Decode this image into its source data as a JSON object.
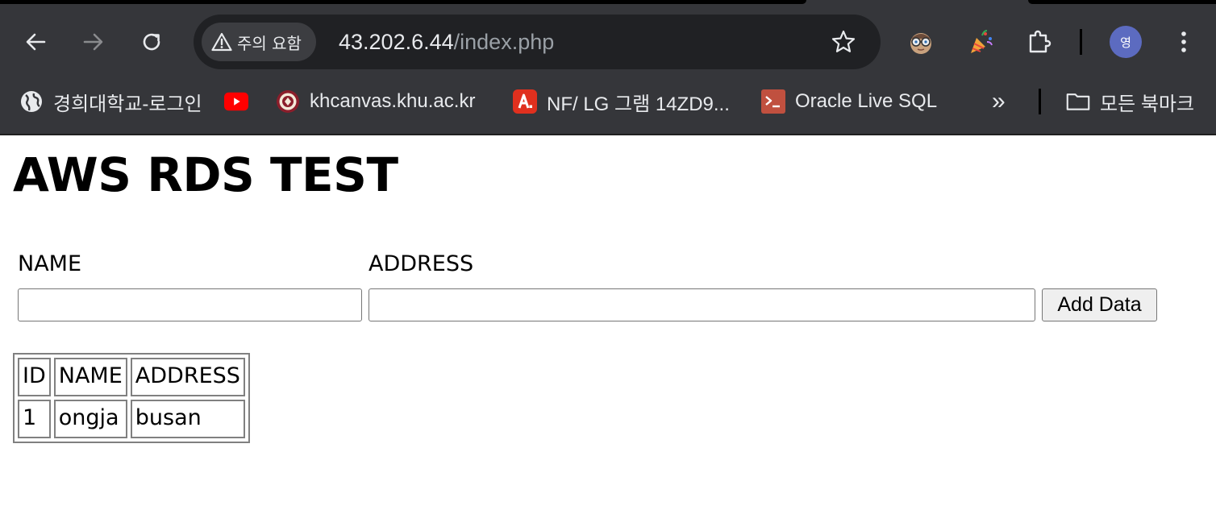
{
  "browser": {
    "security_label": "주의 요함",
    "url_host": "43.202.6.44",
    "url_path": "/index.php",
    "profile_initial": "영",
    "bookmarks": [
      {
        "label": "경희대학교-로그인",
        "icon": "globe-icon"
      },
      {
        "label": "",
        "icon": "youtube-icon"
      },
      {
        "label": "khcanvas.khu.ac.kr",
        "icon": "khu-seal-icon"
      },
      {
        "label": "NF/ LG 그램 14ZD9...",
        "icon": "acrobat-icon"
      },
      {
        "label": "Oracle Live SQL",
        "icon": "terminal-icon"
      }
    ],
    "overflow_label": "»",
    "all_bookmarks_label": "모든 북마크"
  },
  "page": {
    "title": "AWS RDS TEST",
    "form": {
      "name_label": "NAME",
      "address_label": "ADDRESS",
      "name_value": "",
      "address_value": "",
      "submit_label": "Add Data"
    },
    "table": {
      "headers": [
        "ID",
        "NAME",
        "ADDRESS"
      ],
      "rows": [
        [
          "1",
          "ongja",
          "busan"
        ]
      ]
    }
  },
  "colors": {
    "chrome_bg": "#35363a",
    "omnibox_bg": "#202124",
    "chip_bg": "#3c3d41",
    "text_light": "#e8eaed",
    "text_dim": "#9aa0a6",
    "avatar_bg": "#5c6bc0"
  }
}
